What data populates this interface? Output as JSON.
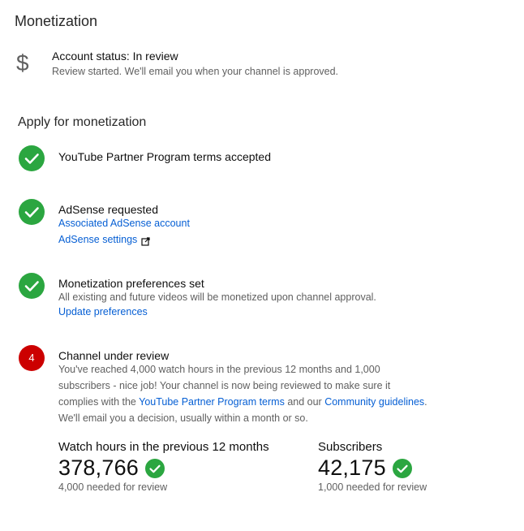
{
  "header": {
    "title": "Monetization"
  },
  "account": {
    "icon": "dollar-icon",
    "status_label": "Account status: In review",
    "status_desc": "Review started. We'll email you when your channel is approved."
  },
  "apply": {
    "title": "Apply for monetization",
    "steps": [
      {
        "title": "YouTube Partner Program terms accepted"
      },
      {
        "title": "AdSense requested",
        "link1": "Associated AdSense account",
        "link2": "AdSense settings"
      },
      {
        "title": "Monetization preferences set",
        "desc": "All existing and future videos will be monetized upon channel approval.",
        "link": "Update preferences"
      },
      {
        "number": "4",
        "title": "Channel under review",
        "line1": "You've reached 4,000 watch hours in the previous 12 months and 1,000",
        "line2": "subscribers - nice job! Your channel is now being reviewed to make sure it",
        "line3_pre": "complies with the ",
        "line3_link1": "YouTube Partner Program terms",
        "line3_mid": " and our ",
        "line3_link2": "Community guidelines",
        "line3_post": ".",
        "line4": "We'll email you a decision, usually within a month or so."
      }
    ]
  },
  "stats": {
    "watch_hours": {
      "label": "Watch hours in the previous 12 months",
      "value": "378,766",
      "note": "4,000 needed for review"
    },
    "subscribers": {
      "label": "Subscribers",
      "value": "42,175",
      "note": "1,000 needed for review"
    }
  },
  "colors": {
    "check_green": "#2ba640",
    "review_red": "#cc0000",
    "link_blue": "#065fd4"
  }
}
